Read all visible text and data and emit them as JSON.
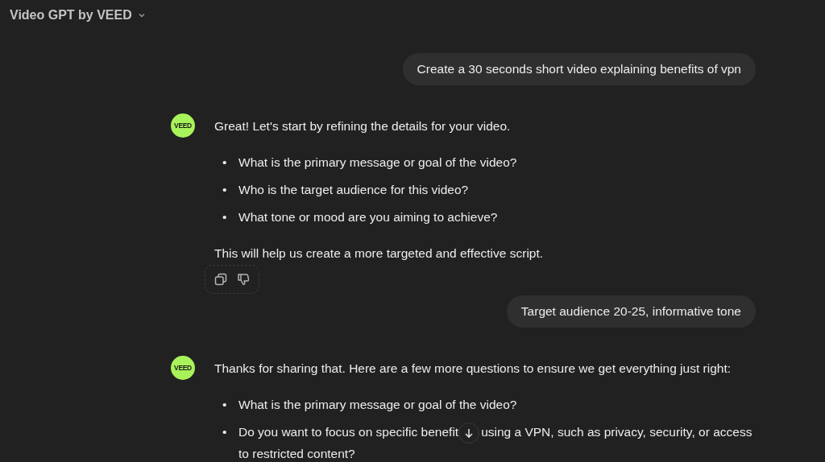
{
  "header": {
    "title": "Video GPT by VEED"
  },
  "messages": [
    {
      "kind": "user",
      "text": "Create a 30 seconds short video explaining benefits of vpn"
    },
    {
      "kind": "assistant",
      "avatar": "VEED",
      "intro": "Great! Let's start by refining the details for your video.",
      "bullets": [
        {
          "marker": "•",
          "text": "What is the primary message or goal of the video?"
        },
        {
          "marker": "•",
          "text": "Who is the target audience for this video?"
        },
        {
          "marker": "•",
          "text": "What tone or mood are you aiming to achieve?"
        }
      ],
      "outro": "This will help us create a more targeted and effective script.",
      "actions": true
    },
    {
      "kind": "user",
      "text": "Target audience 20-25, informative tone"
    },
    {
      "kind": "assistant",
      "avatar": "VEED",
      "intro": "Thanks for sharing that. Here are a few more questions to ensure we get everything just right:",
      "bullets": [
        {
          "marker": "•",
          "text": "What is the primary message or goal of the video?"
        },
        {
          "marker": "•",
          "parts": [
            "Do you want to focus on specific benefit",
            "using a VPN, such as privacy, security, or access",
            "to restricted content?"
          ]
        }
      ]
    }
  ]
}
